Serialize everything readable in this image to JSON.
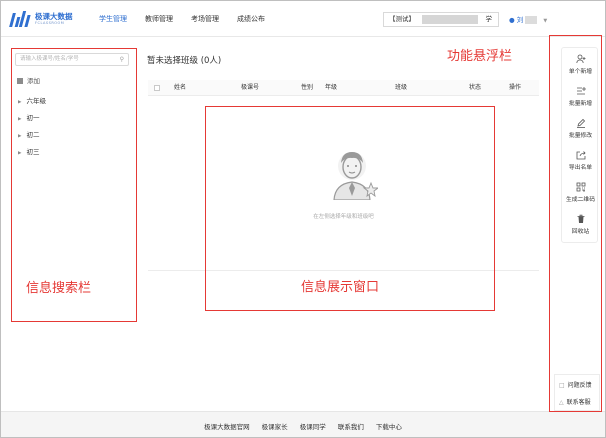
{
  "header": {
    "logo_title": "极课大数据",
    "logo_sub": "FCLASSROOM",
    "nav": [
      {
        "label": "学生管理",
        "active": true
      },
      {
        "label": "教师管理",
        "active": false
      },
      {
        "label": "考场管理",
        "active": false
      },
      {
        "label": "成绩公布",
        "active": false
      }
    ],
    "school_prefix": "【测试】",
    "school_suffix": "学",
    "user_name": "刘"
  },
  "sidebar": {
    "search_placeholder": "请输入极课号/姓名/学号",
    "add_label": "添加",
    "grades": [
      "六年级",
      "初一",
      "初二",
      "初三"
    ]
  },
  "main": {
    "title": "暂未选择班级 (0人)",
    "columns": [
      "姓名",
      "极课号",
      "性别",
      "年级",
      "班级",
      "状态",
      "操作"
    ],
    "empty_text": "在左侧选择年级和班级吧"
  },
  "float_bar": {
    "items": [
      {
        "label": "单个新增",
        "icon": "add-user-icon"
      },
      {
        "label": "批量新增",
        "icon": "batch-add-icon"
      },
      {
        "label": "批量修改",
        "icon": "edit-icon"
      },
      {
        "label": "导出名单",
        "icon": "export-icon"
      },
      {
        "label": "生成二维码",
        "icon": "qr-code-icon"
      },
      {
        "label": "回收站",
        "icon": "trash-icon"
      }
    ]
  },
  "help": {
    "feedback": "问题反馈",
    "contact": "联系客服"
  },
  "footer": {
    "links": [
      "极课大数据官网",
      "极课家长",
      "极课同学",
      "联系我们",
      "下载中心"
    ]
  },
  "annotations": {
    "search_area": "信息搜索栏",
    "display_area": "信息展示窗口",
    "float_area": "功能悬浮栏",
    "color": "#e53935"
  }
}
